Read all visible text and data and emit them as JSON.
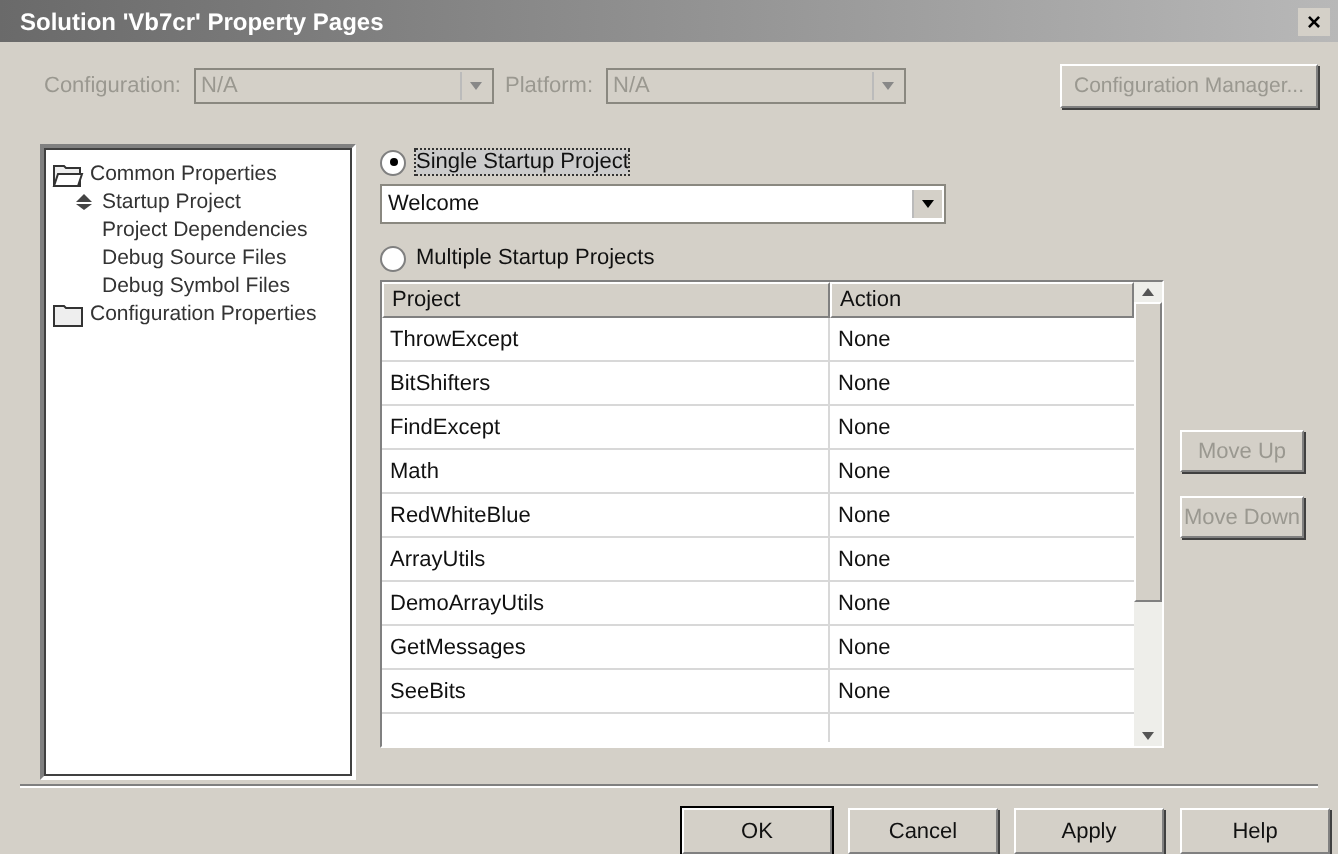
{
  "window": {
    "title": "Solution 'Vb7cr' Property Pages",
    "close": "×"
  },
  "toolbar": {
    "configuration": {
      "label": "Configuration:",
      "value": "N/A",
      "disabled": true
    },
    "platform": {
      "label": "Platform:",
      "value": "N/A",
      "disabled": true
    },
    "manager_button": {
      "label": "Configuration Manager...",
      "disabled": true
    }
  },
  "tree": [
    {
      "label": "Common Properties",
      "expanded": true,
      "selected": false,
      "children": [
        {
          "label": "Startup Project",
          "selected": true
        },
        {
          "label": "Project Dependencies",
          "selected": false
        },
        {
          "label": "Debug Source Files",
          "selected": false
        },
        {
          "label": "Debug Symbol Files",
          "selected": false
        }
      ]
    },
    {
      "label": "Configuration Properties",
      "expanded": false,
      "selected": false
    }
  ],
  "startup_options": [
    {
      "label": "Single Startup Project",
      "selected": true
    },
    {
      "label": "Multiple Startup Projects",
      "selected": false
    }
  ],
  "single_project": {
    "value": "Welcome"
  },
  "table": {
    "columns": [
      "Project",
      "Action"
    ],
    "rows": [
      [
        "ThrowExcept",
        "None"
      ],
      [
        "BitShifters",
        "None"
      ],
      [
        "FindExcept",
        "None"
      ],
      [
        "Math",
        "None"
      ],
      [
        "RedWhiteBlue",
        "None"
      ],
      [
        "ArrayUtils",
        "None"
      ],
      [
        "DemoArrayUtils",
        "None"
      ],
      [
        "GetMessages",
        "None"
      ],
      [
        "SeeBits",
        "None"
      ]
    ]
  },
  "side_buttons": [
    {
      "label": "Move Up",
      "disabled": true
    },
    {
      "label": "Move Down",
      "disabled": true
    }
  ],
  "buttons": [
    {
      "label": "OK",
      "default": true
    },
    {
      "label": "Cancel",
      "default": false
    },
    {
      "label": "Apply",
      "default": false
    },
    {
      "label": "Help",
      "default": false
    }
  ]
}
